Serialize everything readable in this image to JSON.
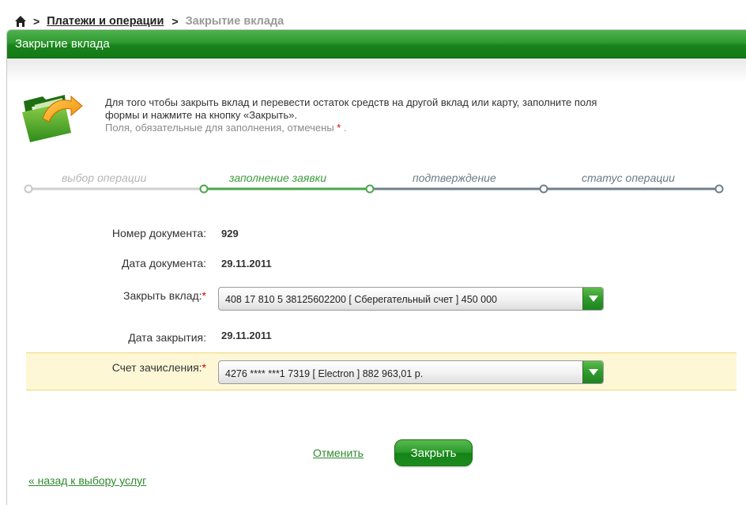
{
  "breadcrumb": {
    "separator": ">",
    "link": "Платежи и операции",
    "current": "Закрытие вклада"
  },
  "panel": {
    "title": "Закрытие вклада"
  },
  "info": {
    "line1": "Для того чтобы закрыть вклад и перевести остаток средств на другой вклад или карту, заполните поля",
    "line2": "формы и нажмите на кнопку «Закрыть».",
    "required_note": "Поля, обязательные для заполнения, отмечены",
    "required_star": "*",
    "required_end": "."
  },
  "steps": [
    {
      "label": "выбор операции",
      "state": "done"
    },
    {
      "label": "заполнение заявки",
      "state": "active"
    },
    {
      "label": "подтверждение",
      "state": "todo"
    },
    {
      "label": "статус операции",
      "state": "todo"
    }
  ],
  "form": {
    "doc_number_label": "Номер документа:",
    "doc_number_value": "929",
    "doc_date_label": "Дата документа:",
    "doc_date_value": "29.11.2011",
    "close_deposit_label": "Закрыть вклад:",
    "close_deposit_value": "408 17 810 5 38125602200  [ Сберегательный счет ]  450 000",
    "close_date_label": "Дата закрытия:",
    "close_date_value": "29.11.2011",
    "credit_account_label": "Счет зачисления:",
    "credit_account_value": "4276 **** ***1 7319   [ Electron ] 882 963,01  р.",
    "required_star": "*"
  },
  "actions": {
    "cancel": "Отменить",
    "close": "Закрыть",
    "back": "« назад к выбору услуг"
  },
  "colors": {
    "brand_green": "#1a831c",
    "active_step": "#3c9a3c",
    "highlight_bg": "#fdf7d6",
    "required": "#d40000"
  },
  "icons": {
    "home": "home-icon",
    "folder": "folder-transfer-icon",
    "dropdown": "chevron-down-icon"
  }
}
